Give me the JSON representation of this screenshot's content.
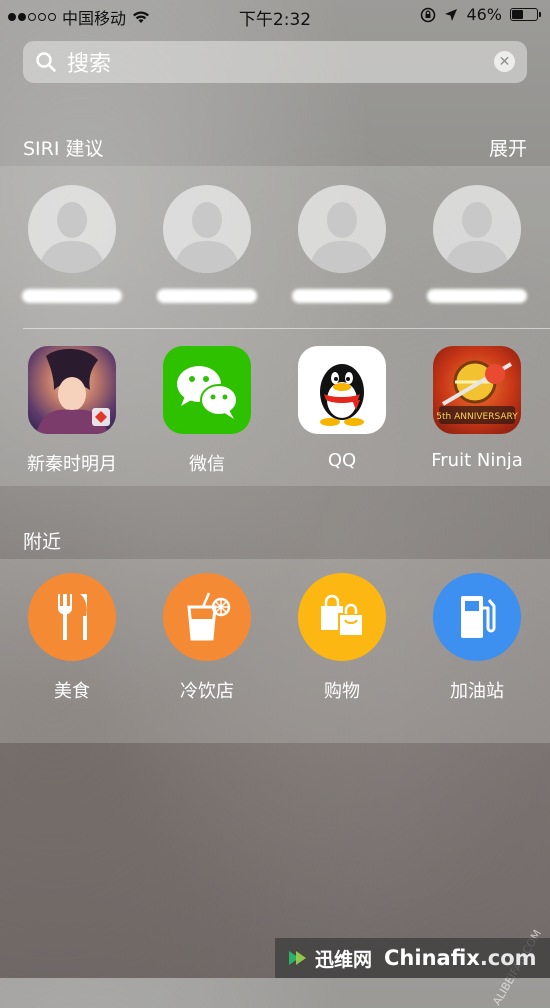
{
  "status_bar": {
    "carrier": "中国移动",
    "time": "下午2:32",
    "battery_percent": "46%",
    "battery_level": 0.46,
    "signal_dots_filled": 2,
    "signal_dots_total": 5
  },
  "search": {
    "placeholder": "搜索"
  },
  "siri": {
    "title": "SIRI 建议",
    "action": "展开",
    "contacts_count": 4,
    "apps": [
      {
        "label": "新秦时明月",
        "icon": "game-app-icon"
      },
      {
        "label": "微信",
        "icon": "wechat-app-icon"
      },
      {
        "label": "QQ",
        "icon": "qq-app-icon"
      },
      {
        "label": "Fruit Ninja",
        "icon": "fruit-ninja-app-icon"
      }
    ]
  },
  "nearby": {
    "title": "附近",
    "items": [
      {
        "label": "美食",
        "icon": "fork-knife-icon",
        "color": "#F58A34"
      },
      {
        "label": "冷饮店",
        "icon": "drink-icon",
        "color": "#F58A34"
      },
      {
        "label": "购物",
        "icon": "shopping-bag-icon",
        "color": "#FDB713"
      },
      {
        "label": "加油站",
        "icon": "gas-pump-icon",
        "color": "#3D8FF0"
      }
    ]
  },
  "watermark": {
    "cn": "迅维网",
    "en_main": "Chinafix",
    "en_sub": ".com",
    "side": "ALIBEIFAN.COM"
  }
}
